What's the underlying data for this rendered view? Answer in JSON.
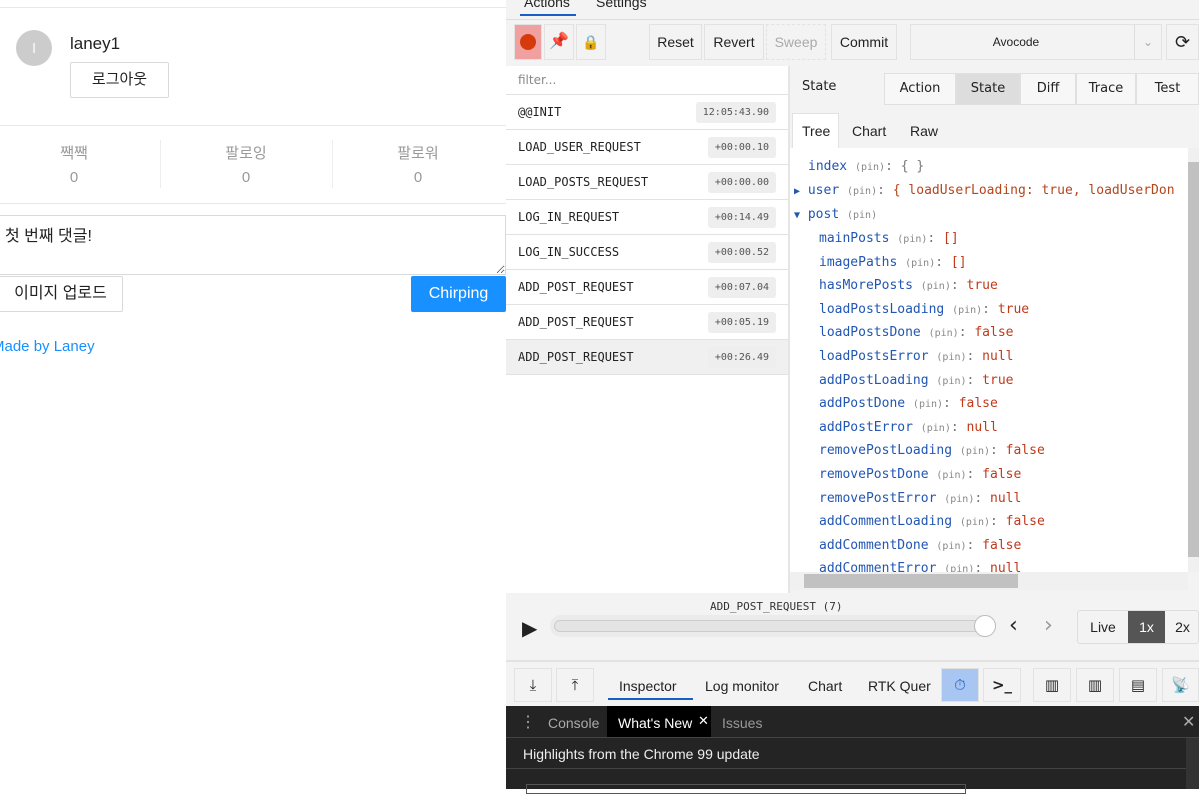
{
  "app": {
    "avatar_initial": "l",
    "username": "laney1",
    "logout": "로그아웃",
    "stats": [
      {
        "label": "짹짹",
        "value": "0"
      },
      {
        "label": "팔로잉",
        "value": "0"
      },
      {
        "label": "팔로워",
        "value": "0"
      }
    ],
    "comment_value": "첫 번째 댓글!",
    "upload": "이미지 업로드",
    "submit": "Chirping",
    "footer": "Made by Laney"
  },
  "devtools": {
    "tabs": [
      "Actions",
      "Settings"
    ],
    "toolbar": {
      "reset": "Reset",
      "revert": "Revert",
      "sweep": "Sweep",
      "commit": "Commit",
      "instance": "Avocode"
    },
    "filter_placeholder": "filter...",
    "actions": [
      {
        "name": "@@INIT",
        "time": "12:05:43.90"
      },
      {
        "name": "LOAD_USER_REQUEST",
        "time": "+00:00.10"
      },
      {
        "name": "LOAD_POSTS_REQUEST",
        "time": "+00:00.00"
      },
      {
        "name": "LOG_IN_REQUEST",
        "time": "+00:14.49"
      },
      {
        "name": "LOG_IN_SUCCESS",
        "time": "+00:00.52"
      },
      {
        "name": "ADD_POST_REQUEST",
        "time": "+00:07.04"
      },
      {
        "name": "ADD_POST_REQUEST",
        "time": "+00:05.19"
      },
      {
        "name": "ADD_POST_REQUEST",
        "time": "+00:26.49"
      }
    ],
    "panel_title": "State",
    "panel_tabs": [
      "Action",
      "State",
      "Diff",
      "Trace",
      "Test"
    ],
    "sub_tabs": [
      "Tree",
      "Chart",
      "Raw"
    ],
    "pin": "(pin)",
    "tree": {
      "index": {
        "key": "index",
        "value": "{ }"
      },
      "user": {
        "key": "user",
        "value": "{ loadUserLoading: true, loadUserDon"
      },
      "post": {
        "key": "post"
      },
      "post_items": [
        {
          "key": "mainPosts",
          "value": "[]"
        },
        {
          "key": "imagePaths",
          "value": "[]"
        },
        {
          "key": "hasMorePosts",
          "value": "true"
        },
        {
          "key": "loadPostsLoading",
          "value": "true"
        },
        {
          "key": "loadPostsDone",
          "value": "false"
        },
        {
          "key": "loadPostsError",
          "value": "null"
        },
        {
          "key": "addPostLoading",
          "value": "true"
        },
        {
          "key": "addPostDone",
          "value": "false"
        },
        {
          "key": "addPostError",
          "value": "null"
        },
        {
          "key": "removePostLoading",
          "value": "false"
        },
        {
          "key": "removePostDone",
          "value": "false"
        },
        {
          "key": "removePostError",
          "value": "null"
        },
        {
          "key": "addCommentLoading",
          "value": "false"
        },
        {
          "key": "addCommentDone",
          "value": "false"
        },
        {
          "key": "addCommentError",
          "value": "null"
        }
      ]
    },
    "slider": {
      "label": "ADD_POST_REQUEST (7)",
      "progress": 1.0
    },
    "speed": [
      "Live",
      "1x",
      "2x"
    ],
    "monitors": [
      "Inspector",
      "Log monitor",
      "Chart",
      "RTK Quer"
    ]
  },
  "drawer": {
    "tabs": [
      "Console",
      "What's New",
      "Issues"
    ],
    "headline": "Highlights from the Chrome 99 update"
  }
}
